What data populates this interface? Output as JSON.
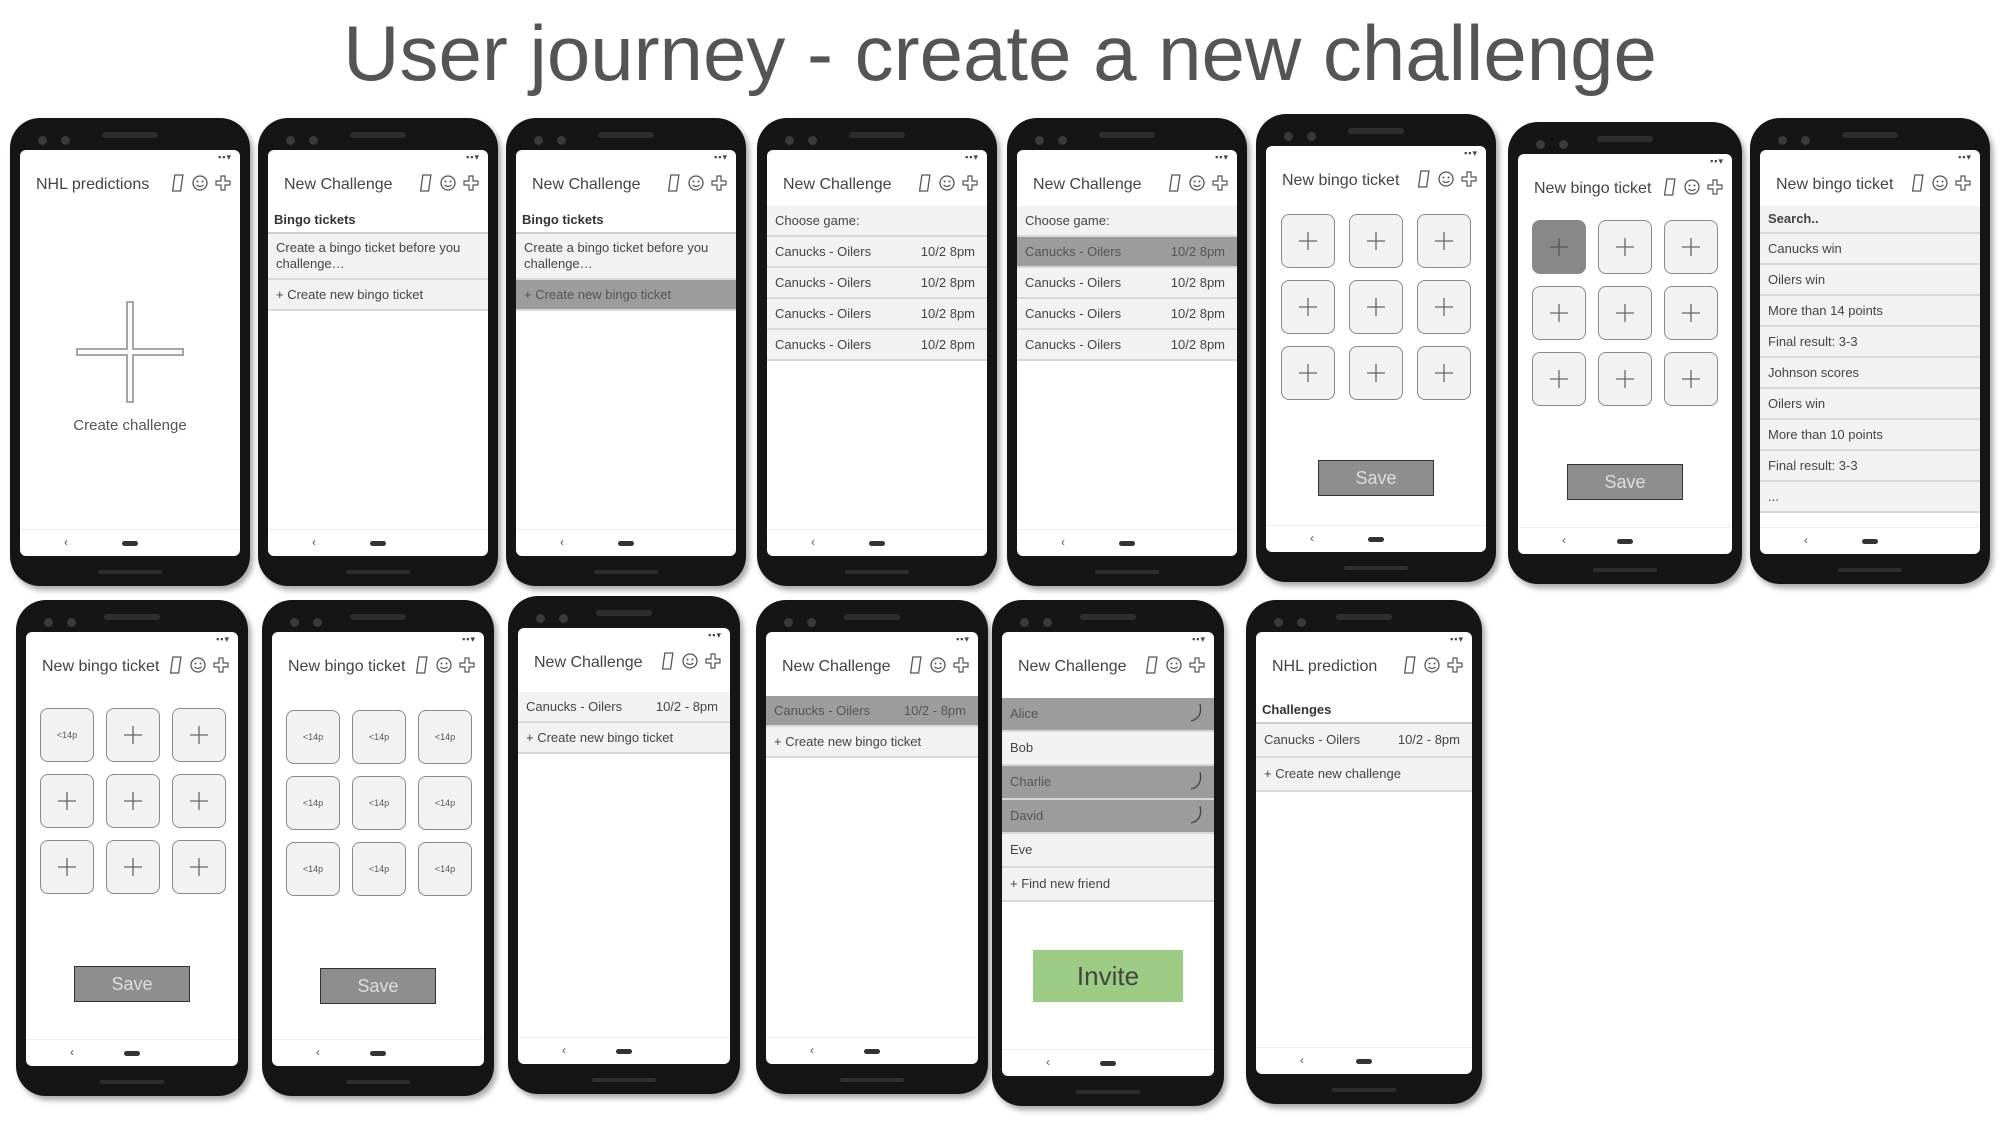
{
  "title": "User journey - create a new challenge",
  "status_icons": "▪▪▾",
  "nav": {
    "back": "‹"
  },
  "screens": {
    "s1": {
      "title": "NHL predictions",
      "create_label": "Create challenge"
    },
    "s2": {
      "title": "New Challenge",
      "section": "Bingo tickets",
      "info": "Create a bingo ticket before you challenge…",
      "action": "+ Create new bingo ticket"
    },
    "s3": {
      "title": "New Challenge",
      "section": "Bingo tickets",
      "info": "Create a bingo ticket before you challenge…",
      "action": "+ Create new bingo ticket"
    },
    "s4": {
      "title": "New Challenge",
      "section": "Choose game:",
      "games": [
        {
          "name": "Canucks - Oilers",
          "date": "10/2 8pm"
        },
        {
          "name": "Canucks - Oilers",
          "date": "10/2 8pm"
        },
        {
          "name": "Canucks - Oilers",
          "date": "10/2 8pm"
        },
        {
          "name": "Canucks - Oilers",
          "date": "10/2 8pm"
        }
      ]
    },
    "s5": {
      "title": "New Challenge",
      "section": "Choose game:",
      "games": [
        {
          "name": "Canucks - Oilers",
          "date": "10/2 8pm"
        },
        {
          "name": "Canucks - Oilers",
          "date": "10/2 8pm"
        },
        {
          "name": "Canucks - Oilers",
          "date": "10/2 8pm"
        },
        {
          "name": "Canucks - Oilers",
          "date": "10/2 8pm"
        }
      ]
    },
    "s6": {
      "title": "New bingo ticket",
      "save": "Save"
    },
    "s7": {
      "title": "New bingo ticket",
      "save": "Save"
    },
    "s8": {
      "title": "New bingo ticket",
      "search": "Search..",
      "options": [
        "Canucks win",
        "Oilers win",
        "More than 14 points",
        "Final result: 3-3",
        "Johnson scores",
        "Oilers win",
        "More than 10 points",
        "Final result: 3-3",
        "..."
      ]
    },
    "s9": {
      "title": "New bingo ticket",
      "save": "Save",
      "filled": "<14p"
    },
    "s10": {
      "title": "New bingo ticket",
      "save": "Save",
      "filled": "<14p"
    },
    "s11": {
      "title": "New Challenge",
      "ticket": "Canucks - Oilers",
      "date": "10/2 - 8pm",
      "action": "+ Create new bingo ticket"
    },
    "s12": {
      "title": "New Challenge",
      "ticket": "Canucks - Oilers",
      "date": "10/2 - 8pm",
      "action": "+ Create new bingo ticket"
    },
    "s13": {
      "title": "New Challenge",
      "friends": [
        "Alice",
        "Bob",
        "Charlie",
        "David",
        "Eve"
      ],
      "find": "+ Find new friend",
      "invite": "Invite"
    },
    "s14": {
      "title": "NHL prediction",
      "section": "Challenges",
      "challenge": "Canucks - Oilers",
      "date": "10/2 - 8pm",
      "action": "+ Create new challenge"
    }
  }
}
